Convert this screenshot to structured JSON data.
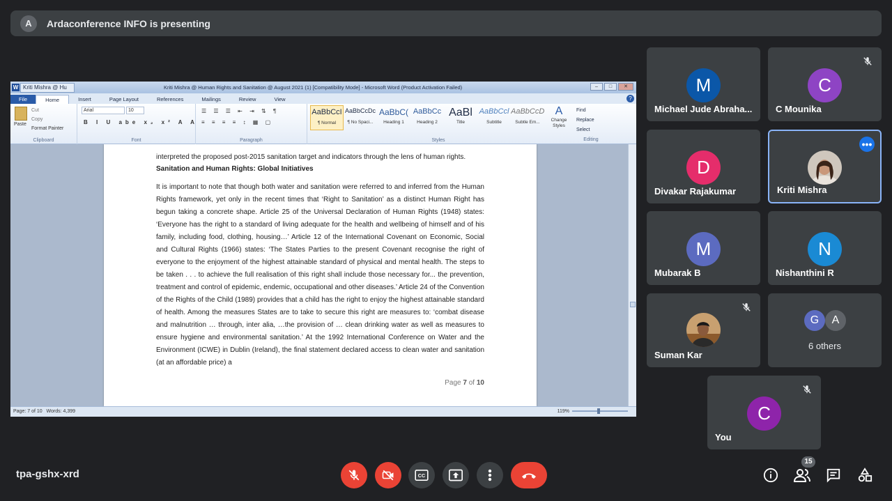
{
  "banner": {
    "avatar_letter": "A",
    "text": "Ardaconference INFO is presenting"
  },
  "word": {
    "doc_tab": "Kriti Mishra @ Hu",
    "title": "Kriti Mishra @ Human Rights and Sanitation @ August 2021 (1) [Compatibility Mode] - Microsoft Word (Product Activation Failed)",
    "tabs": [
      "File",
      "Home",
      "Insert",
      "Page Layout",
      "References",
      "Mailings",
      "Review",
      "View"
    ],
    "clipboard": {
      "paste": "Paste",
      "cut": "Cut",
      "copy": "Copy",
      "format_painter": "Format Painter",
      "label": "Clipboard"
    },
    "font": {
      "name": "Arial",
      "size": "10",
      "label": "Font"
    },
    "paragraph_label": "Paragraph",
    "styles": [
      {
        "preview": "AaBbCcI",
        "name": "¶ Normal"
      },
      {
        "preview": "AaBbCcDc",
        "name": "¶ No Spaci..."
      },
      {
        "preview": "AaBbC(",
        "name": "Heading 1"
      },
      {
        "preview": "AaBbCc",
        "name": "Heading 2"
      },
      {
        "preview": "AaBl",
        "name": "Title"
      },
      {
        "preview": "AaBbCcl",
        "name": "Subtitle"
      },
      {
        "preview": "AaBbCcD",
        "name": "Subtle Em..."
      }
    ],
    "styles_label": "Styles",
    "change_styles": "Change Styles",
    "editing": {
      "find": "Find",
      "replace": "Replace",
      "select": "Select",
      "label": "Editing"
    },
    "doc": {
      "line0": "interpreted the proposed post-2015 sanitation target and indicators through the lens of human rights.",
      "heading": "Sanitation and Human Rights: Global Initiatives",
      "paragraph": "It is important to note that though both water and sanitation were referred to and inferred from the Human Rights framework, yet only in the recent times that ‘Right to Sanitation’ as a distinct Human Right has begun taking a concrete shape. Article 25 of the Universal Declaration of Human Rights (1948) states: ‘Everyone has the right to a standard of living adequate for the health and wellbeing of himself and of his family, including food, clothing, housing…’ Article 12 of the International Covenant on Economic, Social and Cultural Rights (1966) states: ‘The States Parties to the present Covenant recognise the right of everyone to the enjoyment of the highest attainable standard of physical and mental health. The steps to be taken . . . to achieve the full realisation of this right shall include those necessary for... the prevention, treatment and control of epidemic, endemic, occupational and other diseases.’ Article 24 of the Convention of the Rights of the Child (1989) provides that a child has the right to enjoy the highest attainable standard of health. Among the measures States are to take to secure this right are measures to: ‘combat disease and malnutrition … through, inter alia, …the provision of … clean drinking water as well as measures to ensure hygiene and environmental sanitation.’ At the 1992 International Conference on Water and the Environment (ICWE) in Dublin (Ireland), the final statement declared access to clean water and sanitation (at an affordable price) a",
      "page_prefix": "Page ",
      "page_current": "7",
      "page_of": " of ",
      "page_total": "10"
    },
    "status": {
      "page": "Page: 7 of 10",
      "words": "Words: 4,399",
      "zoom": "119%"
    }
  },
  "participants": [
    {
      "name": "Michael Jude Abraha...",
      "letter": "M",
      "color": "#0b57a8"
    },
    {
      "name": "C Mounika",
      "letter": "C",
      "color": "#8e44c4",
      "muted": true
    },
    {
      "name": "Divakar Rajakumar",
      "letter": "D",
      "color": "#e52d6b"
    },
    {
      "name": "Kriti Mishra",
      "active": true
    },
    {
      "name": "Mubarak B",
      "letter": "M",
      "color": "#5c6bc0"
    },
    {
      "name": "Nishanthini R",
      "letter": "N",
      "color": "#1a8ad4"
    },
    {
      "name": "Suman Kar",
      "muted": true
    },
    {
      "name": "6 others",
      "letters": [
        "G",
        "A"
      ]
    },
    {
      "name": "You",
      "letter": "C",
      "color": "#8e24aa",
      "muted": true
    }
  ],
  "bottom": {
    "meeting_code": "tpa-gshx-xrd",
    "people_count": "15"
  }
}
